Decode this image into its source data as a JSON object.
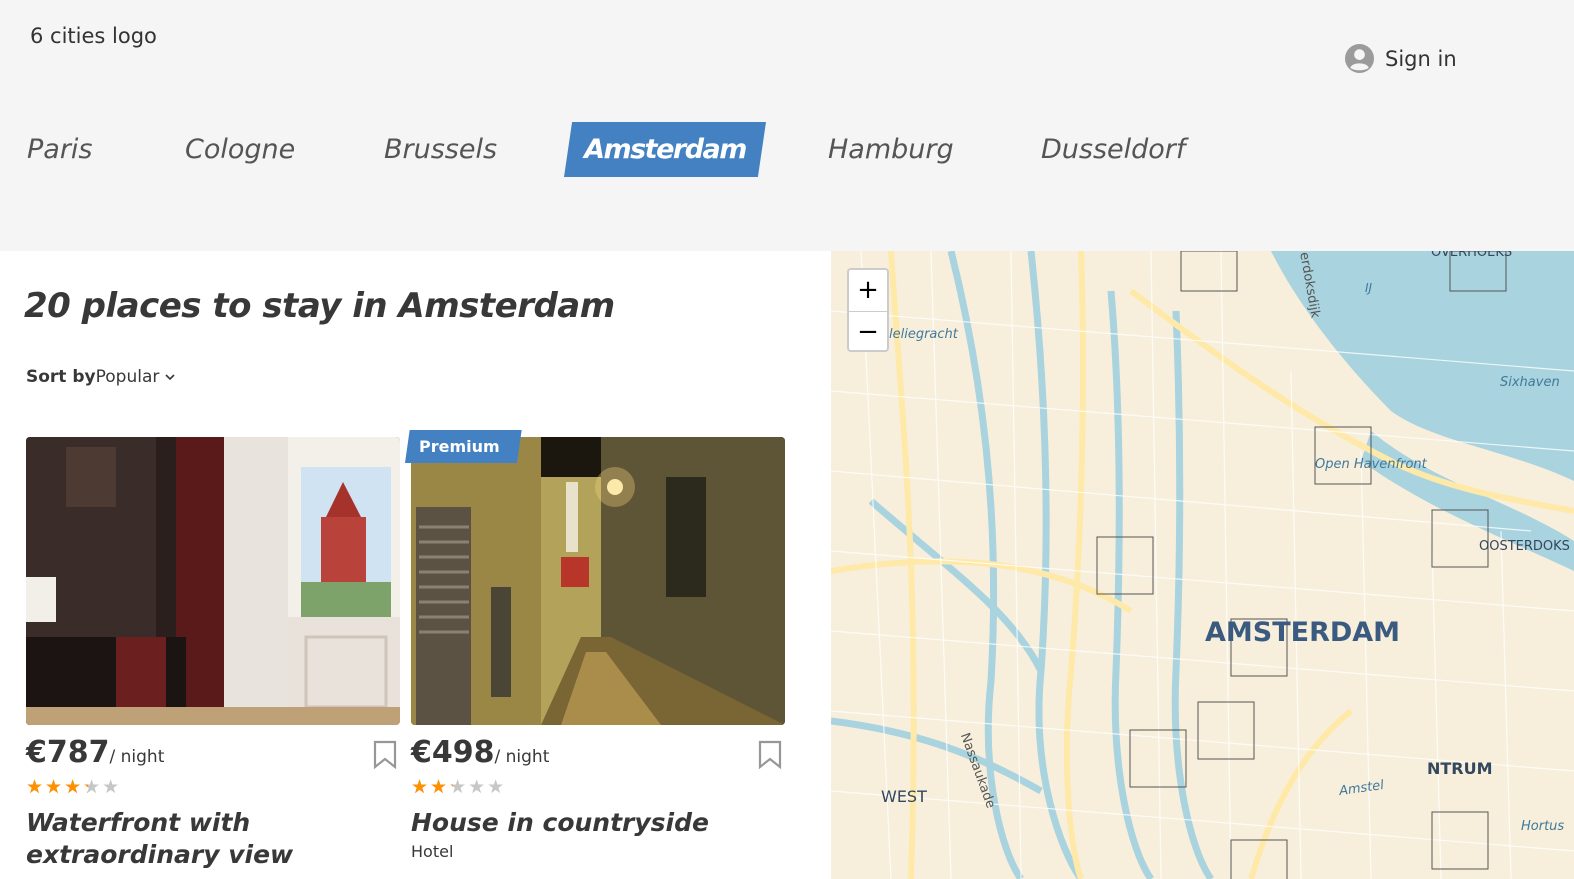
{
  "header": {
    "logo_text": "6 cities logo",
    "sign_in_label": "Sign in"
  },
  "city_tabs": [
    {
      "label": "Paris",
      "active": false
    },
    {
      "label": "Cologne",
      "active": false
    },
    {
      "label": "Brussels",
      "active": false
    },
    {
      "label": "Amsterdam",
      "active": true
    },
    {
      "label": "Hamburg",
      "active": false
    },
    {
      "label": "Dusseldorf",
      "active": false
    }
  ],
  "main": {
    "title": "20 places to stay in Amsterdam",
    "sort_label": "Sort by",
    "sort_value": "Popular"
  },
  "offers": [
    {
      "premium": false,
      "price": "€787",
      "price_unit": "/ night",
      "rating_fraction": 0.6,
      "name": "Waterfront with extraordinary view",
      "type": ""
    },
    {
      "premium": true,
      "premium_label": "Premium",
      "price": "€498",
      "price_unit": "/ night",
      "rating_fraction": 0.4,
      "name": "House in countryside",
      "type": "Hotel"
    }
  ],
  "map": {
    "zoom_in": "+",
    "zoom_out": "−",
    "labels": {
      "city": "AMSTERDAM",
      "west": "WEST",
      "centrum": "NTRUM",
      "oosterdok": "OOSTERDOKS",
      "overhoeks": "OVERHOEKS",
      "open_havenfront": "Open Havenfront",
      "sixhaven": "Sixhaven",
      "ij": "IJ",
      "nassaukade": "Nassaukade",
      "bloemgracht": "leliegracht",
      "westerdoksdijk": "erdoksdijk",
      "amstel": "Amstel",
      "hortus": "Hortus"
    }
  },
  "colors": {
    "accent": "#4481c3",
    "star": "#ff9000",
    "star_empty": "#c7c7c7",
    "header_bg": "#f5f5f5",
    "map_water": "#a9d3de",
    "map_land": "#f7efdc"
  }
}
